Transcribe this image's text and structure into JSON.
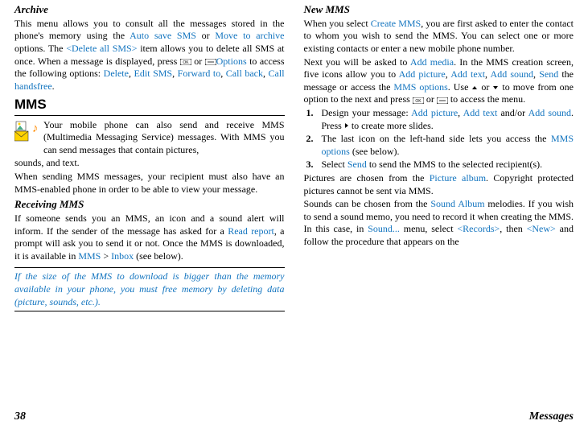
{
  "left": {
    "archive_heading": "Archive",
    "archive_p_1a": "This menu allows you to consult all the messages stored in the phone's memory using the ",
    "archive_lk_auto": "Auto save SMS",
    "archive_p_1b": " or ",
    "archive_lk_move": "Move to archive",
    "archive_p_1c": " options. The ",
    "archive_lk_delete": "<Delete all SMS>",
    "archive_p_1d": " item allows you to delete all SMS at once. When a message is displayed, press ",
    "archive_p_1e": " or ",
    "archive_lk_options": "Options",
    "archive_p_1f": " to access the following options: ",
    "lk_del": "Delete",
    "sep1": ", ",
    "lk_edit": "Edit SMS",
    "sep2": ", ",
    "lk_fwd": "Forward to",
    "sep3": ", ",
    "lk_call": "Call back",
    "sep4": ", ",
    "lk_hands": "Call handsfree",
    "end1": ".",
    "mms_heading": "MMS",
    "mms_desc": "Your mobile phone can also send and receive MMS (Multimedia Messaging Service) messages. With MMS you can send messages that contain pictures, sounds, and text.",
    "mms_p2": "When sending MMS messages, your recipient must also have an MMS-enabled phone in order to be able to view your message.",
    "recv_heading": "Receiving MMS",
    "recv_p1a": "If someone sends you an MMS, an icon and a sound alert will inform. If the sender of the message has asked for a ",
    "recv_lk_read": "Read report",
    "recv_p1b": ", a prompt will ask you to send it or not. Once the MMS is downloaded, it is available in ",
    "recv_lk_mms": "MMS",
    "recv_gt": " > ",
    "recv_lk_inbox": "Inbox",
    "recv_p1c": " (see below).",
    "note": "If the size of the MMS to download is bigger than the memory available in your phone, you must free memory by deleting data (picture, sounds, etc.)."
  },
  "right": {
    "new_heading": "New MMS",
    "p1a": "When you select ",
    "lk_create": "Create MMS",
    "p1b": ", you are first asked to enter the contact to whom you wish to send the MMS. You can select one or more existing contacts or enter a new mobile phone number.",
    "p2a": "Next you will be asked to ",
    "lk_addmedia": "Add media",
    "p2b": ". In the MMS creation screen, five icons allow you to ",
    "lk_addpic": "Add picture",
    "p2c": ", ",
    "lk_addtxt": "Add text",
    "p2d": ", ",
    "lk_addsnd": "Add sound",
    "p2e": ", ",
    "lk_send": "Send",
    "p2f": " the message or access the ",
    "lk_mmsopt": "MMS options",
    "p2g": ". Use ",
    "p2h": " or ",
    "p2i": " to move from one option to the next and press ",
    "p2j": " or ",
    "p2k": " to access the menu.",
    "li1a": "Design your message: ",
    "li1_pic": "Add picture",
    "li1b": ", ",
    "li1_txt": "Add text",
    "li1c": " and/or ",
    "li1_snd": "Add sound",
    "li1d": ". Press ",
    "li1e": " to create more slides.",
    "li2a": "The last icon on the left-hand side lets you access the ",
    "li2_lk": "MMS options",
    "li2b": " (see below).",
    "li3a": "Select ",
    "li3_lk": "Send",
    "li3b": " to send the MMS to the selected recipient(s).",
    "p3a": "Pictures are chosen from the ",
    "lk_album": "Picture album",
    "p3b": ". Copyright protected pictures cannot be sent via MMS.",
    "p4a": "Sounds can be chosen from the ",
    "lk_salbum": "Sound Album",
    "p4b": " melodies. If you wish to send a sound memo, you need to record it when creating the MMS. In this case, in ",
    "lk_smenu": "Sound...",
    "p4c": " menu, select ",
    "lk_rec": "<Records>",
    "p4d": ", then ",
    "lk_new": "<New>",
    "p4e": " and follow the procedure that appears on the"
  },
  "footer": {
    "page": "38",
    "section": "Messages"
  }
}
